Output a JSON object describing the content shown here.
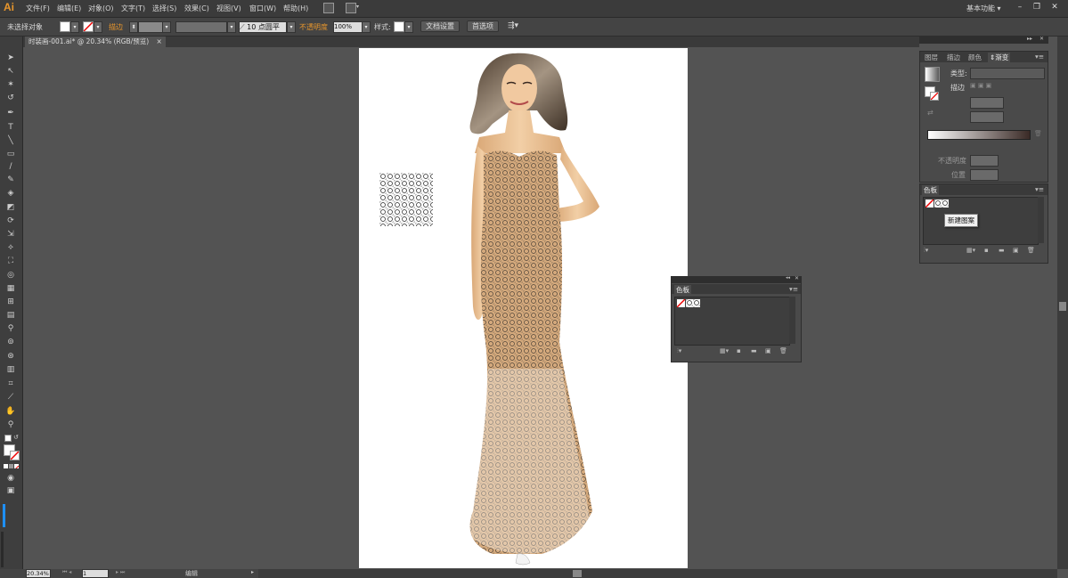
{
  "app": {
    "logo": "Ai"
  },
  "menu": [
    "文件(F)",
    "编辑(E)",
    "对象(O)",
    "文字(T)",
    "选择(S)",
    "效果(C)",
    "视图(V)",
    "窗口(W)",
    "帮助(H)"
  ],
  "workspace": {
    "label": "基本功能",
    "arrow": "▾"
  },
  "window_controls": {
    "minimize": "–",
    "restore": "❐",
    "close": "✕"
  },
  "control_bar": {
    "selection_status": "未选择对象",
    "stroke_label": "描边",
    "stroke_size": "10",
    "brush_label": "点圆平",
    "opacity_label": "不透明度",
    "opacity_value": "100%",
    "style_label": "样式:",
    "doc_setup_button": "文档设置",
    "preferences_button": "首选项"
  },
  "document_tab": {
    "title": "时装画-001.ai* @ 20.34% (RGB/预览)",
    "close": "×"
  },
  "right_panel": {
    "tabs": [
      "图层",
      "描边",
      "颜色",
      "渐变"
    ],
    "active_tab": "渐变",
    "type_label": "类型:",
    "stroke_label": "描边",
    "opacity_label": "不透明度",
    "position_label": "位置"
  },
  "swatches_panel_docked": {
    "title": "色板",
    "tooltip": "新建图案",
    "menu_icon": "▾≡"
  },
  "swatches_panel_floating": {
    "title": "色板",
    "menu_icon": "▾≡",
    "collapse": "◂◂",
    "close": "✕"
  },
  "status_bar": {
    "zoom": "20.34%",
    "page": "1",
    "mode": "编辑"
  },
  "colors": {
    "menubar": "#3b3b3b",
    "panel": "#4a4a4a",
    "canvas": "#535353",
    "accent": "#e8962c"
  }
}
